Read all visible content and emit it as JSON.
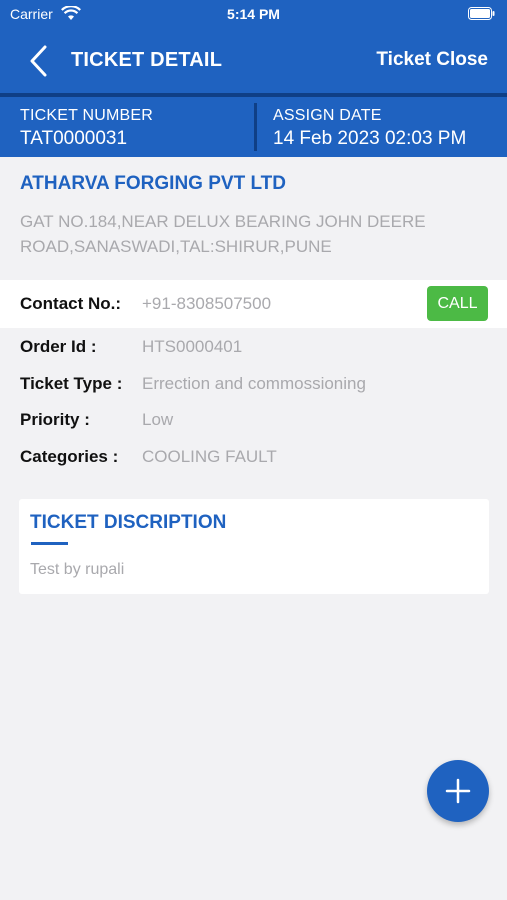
{
  "status_bar": {
    "carrier": "Carrier",
    "time": "5:14 PM"
  },
  "navbar": {
    "title": "TICKET DETAIL",
    "close_label": "Ticket Close"
  },
  "ticket": {
    "number_label": "TICKET NUMBER",
    "number_value": "TAT0000031",
    "assign_label": "ASSIGN DATE",
    "assign_value": "14 Feb 2023 02:03 PM"
  },
  "company": {
    "name": "ATHARVA FORGING PVT LTD",
    "address": "GAT NO.184,NEAR DELUX BEARING JOHN DEERE ROAD,SANASWADI,TAL:SHIRUR,PUNE"
  },
  "contact": {
    "label": "Contact No.:",
    "value": "+91-8308507500",
    "call_label": "CALL"
  },
  "details": [
    {
      "label": "Order Id :",
      "value": "HTS0000401"
    },
    {
      "label": "Ticket Type :",
      "value": "Errection and commossioning"
    },
    {
      "label": "Priority :",
      "value": "Low"
    },
    {
      "label": "Categories :",
      "value": "COOLING FAULT"
    }
  ],
  "description": {
    "title": "TICKET DISCRIPTION",
    "text": "Test by rupali"
  },
  "icons": {
    "back": "chevron-left-icon",
    "fab": "plus-icon",
    "wifi": "wifi-icon",
    "battery": "battery-icon"
  },
  "colors": {
    "primary": "#1f62c0",
    "primary_dark": "#0f3f86",
    "call_green": "#4cba45",
    "muted_text": "#a9a9ad",
    "background": "#f2f2f4"
  }
}
